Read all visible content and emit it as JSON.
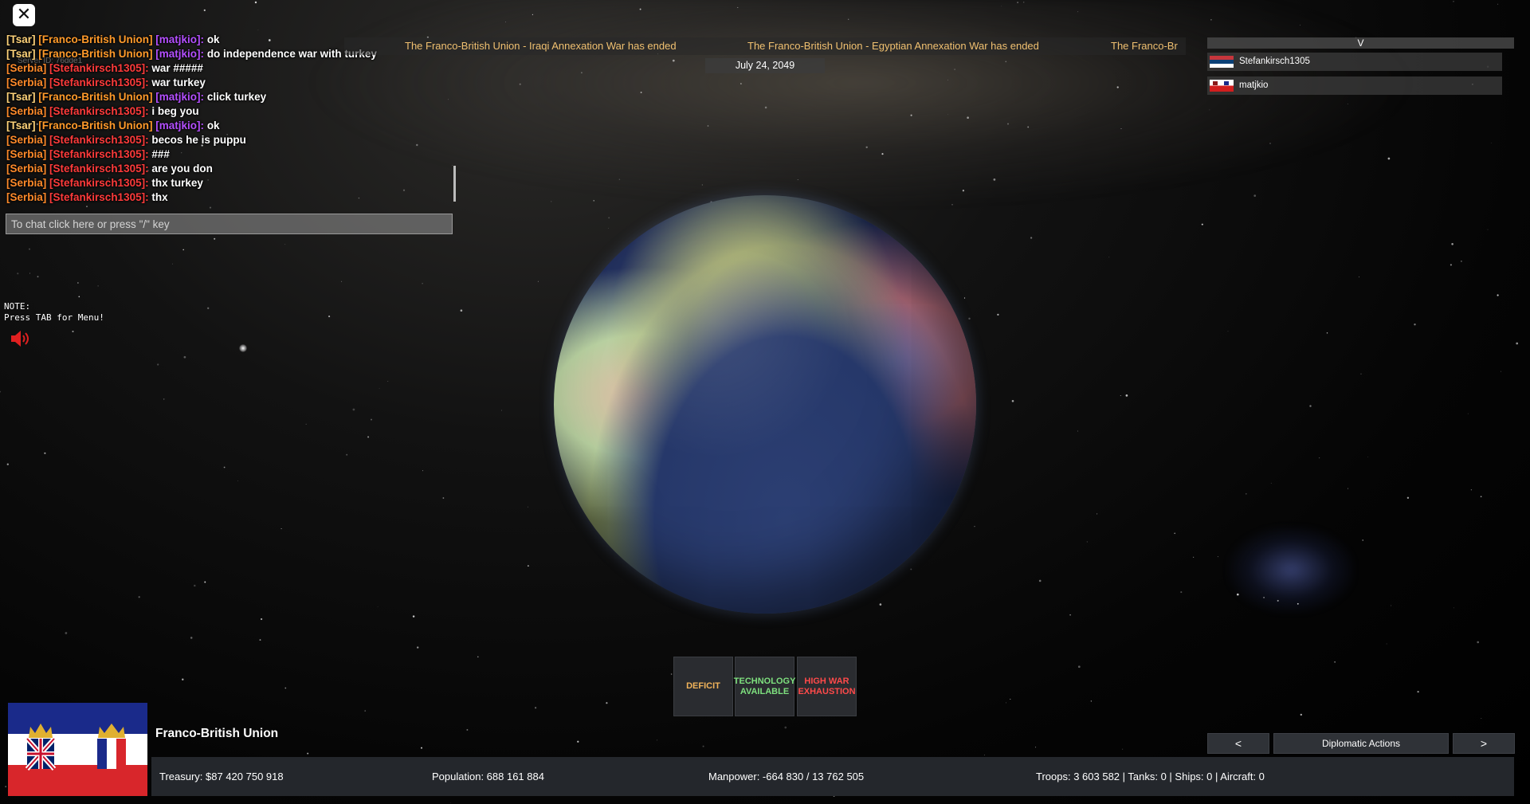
{
  "server_id": "Server ID: 76dde1",
  "chat": {
    "messages": [
      {
        "role": "[Tsar]",
        "country": "[Franco-British Union]",
        "user": "[matjkio]:",
        "text": "ok",
        "c1": "tag-a",
        "c2": "tag-fbu",
        "c3": "tag-user"
      },
      {
        "role": "[Tsar]",
        "country": "[Franco-British Union]",
        "user": "[matjkio]:",
        "text": "do independence war with turkey",
        "c1": "tag-a",
        "c2": "tag-fbu",
        "c3": "tag-user"
      },
      {
        "role": "[Serbia]",
        "country": "[Stefankirsch1305]:",
        "user": "",
        "text": "war #####",
        "c1": "tag-serbia",
        "c2": "tag-red",
        "c3": "tag-user"
      },
      {
        "role": "[Serbia]",
        "country": "[Stefankirsch1305]:",
        "user": "",
        "text": "war turkey",
        "c1": "tag-serbia",
        "c2": "tag-red",
        "c3": "tag-user"
      },
      {
        "role": "[Tsar]",
        "country": "[Franco-British Union]",
        "user": "[matjkio]:",
        "text": "click turkey",
        "c1": "tag-a",
        "c2": "tag-fbu",
        "c3": "tag-user"
      },
      {
        "role": "[Serbia]",
        "country": "[Stefankirsch1305]:",
        "user": "",
        "text": "i beg you",
        "c1": "tag-serbia",
        "c2": "tag-red",
        "c3": "tag-user"
      },
      {
        "role": "[Tsar]",
        "country": "[Franco-British Union]",
        "user": "[matjkio]:",
        "text": "ok",
        "c1": "tag-a",
        "c2": "tag-fbu",
        "c3": "tag-user"
      },
      {
        "role": "[Serbia]",
        "country": "[Stefankirsch1305]:",
        "user": "",
        "text": "becos he is puppu",
        "c1": "tag-serbia",
        "c2": "tag-red",
        "c3": "tag-user"
      },
      {
        "role": "[Serbia]",
        "country": "[Stefankirsch1305]:",
        "user": "",
        "text": "###",
        "c1": "tag-serbia",
        "c2": "tag-red",
        "c3": "tag-user"
      },
      {
        "role": "[Serbia]",
        "country": "[Stefankirsch1305]:",
        "user": "",
        "text": "are you don",
        "c1": "tag-serbia",
        "c2": "tag-red",
        "c3": "tag-user"
      },
      {
        "role": "[Serbia]",
        "country": "[Stefankirsch1305]:",
        "user": "",
        "text": "thx turkey",
        "c1": "tag-serbia",
        "c2": "tag-red",
        "c3": "tag-user"
      },
      {
        "role": "[Serbia]",
        "country": "[Stefankirsch1305]:",
        "user": "",
        "text": "thx",
        "c1": "tag-serbia",
        "c2": "tag-red",
        "c3": "tag-user"
      }
    ],
    "input_placeholder": "To chat click here or press \"/\" key"
  },
  "note": {
    "line1": "NOTE:",
    "line2": "Press TAB for Menu!"
  },
  "ticker": {
    "items": [
      "The Franco-British Union - Iraqi Annexation War has ended",
      "The Franco-British Union - Egyptian Annexation War has ended",
      "The Franco-Br"
    ]
  },
  "date": "July 24, 2049",
  "players": {
    "header": "V",
    "list": [
      "Stefankirsch1305",
      "matjkio"
    ]
  },
  "alerts": {
    "deficit": "DEFICIT",
    "technology": "TECHNOLOGY AVAILABLE",
    "war_exhaustion": "HIGH WAR EXHAUSTION"
  },
  "country": {
    "name": "Franco-British Union"
  },
  "diplomacy": {
    "prev": "<",
    "label": "Diplomatic Actions",
    "next": ">"
  },
  "stats": {
    "treasury": "Treasury:   $87 420 750 918",
    "population": "Population: 688 161 884",
    "manpower": "Manpower:  -664 830  /  13 762 505",
    "military": "Troops: 3 603 582  |  Tanks: 0  |  Ships: 0  |  Aircraft: 0"
  },
  "colors": {
    "alert_deficit": "#f0b35a",
    "alert_technology": "#7ee07e",
    "alert_war": "#ff4a4a"
  },
  "icons": {
    "close": "close-icon",
    "sound": "speaker-icon"
  }
}
